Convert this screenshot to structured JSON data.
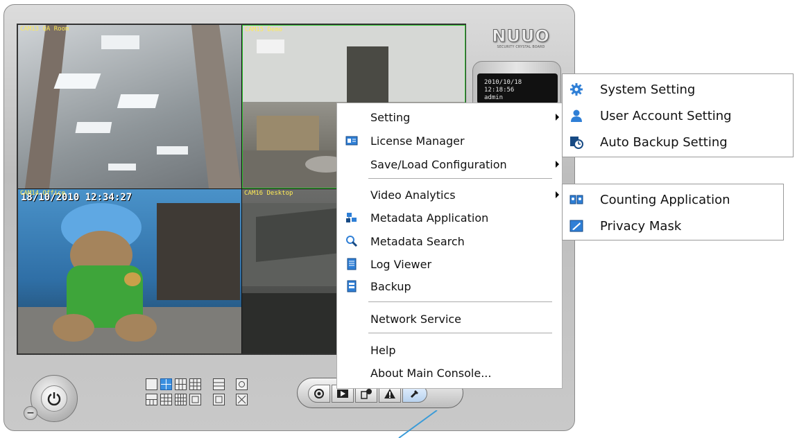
{
  "cameras": [
    {
      "label": "CAM13 QA Room"
    },
    {
      "label": "CAM15 Demo"
    },
    {
      "label": "CAM14 Office",
      "timestamp": "18/10/2010 12:34:27"
    },
    {
      "label": "CAM16 Desktop"
    }
  ],
  "logo": {
    "brand": "NUUO",
    "tagline": "SECURITY CRYSTAL BOARD"
  },
  "status": {
    "date": "2010/10/18",
    "time": "12:18:56",
    "user": "admin"
  },
  "menu": {
    "items": [
      {
        "label": "Setting",
        "icon": "none",
        "submenu": true
      },
      {
        "label": "License Manager",
        "icon": "license-icon"
      },
      {
        "label": "Save/Load Configuration",
        "icon": "none",
        "submenu": true
      },
      {
        "label": "Video Analytics",
        "icon": "none",
        "submenu": true
      },
      {
        "label": "Metadata Application",
        "icon": "metadata-app-icon"
      },
      {
        "label": "Metadata Search",
        "icon": "metadata-search-icon"
      },
      {
        "label": "Log Viewer",
        "icon": "log-icon"
      },
      {
        "label": "Backup",
        "icon": "backup-icon"
      },
      {
        "label": "Network Service",
        "icon": "none"
      },
      {
        "label": "Help",
        "icon": "none"
      },
      {
        "label": "About Main Console...",
        "icon": "none"
      }
    ]
  },
  "setting_submenu": [
    {
      "label": "System Setting",
      "icon": "gear-icon"
    },
    {
      "label": "User Account Setting",
      "icon": "user-icon"
    },
    {
      "label": "Auto Backup Setting",
      "icon": "clock-backup-icon"
    }
  ],
  "analytics_submenu": [
    {
      "label": "Counting Application",
      "icon": "counting-icon"
    },
    {
      "label": "Privacy Mask",
      "icon": "privacy-mask-icon"
    }
  ],
  "colors": {
    "accent": "#2f7fd6",
    "cam_label": "#ffeb55",
    "pointer": "#3a9bd8"
  }
}
